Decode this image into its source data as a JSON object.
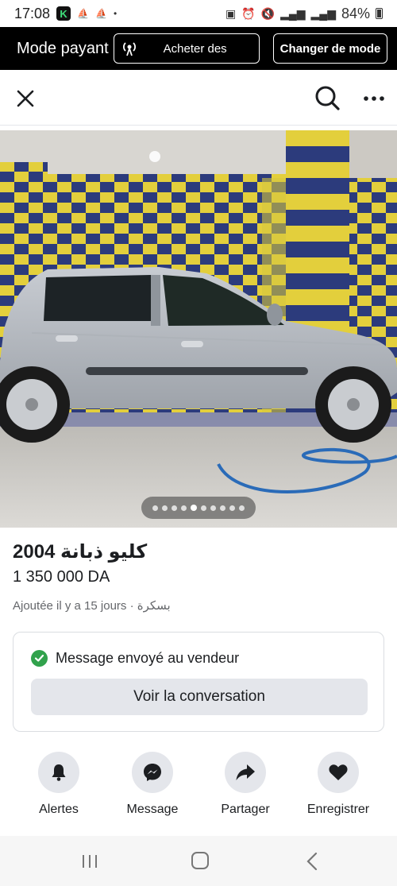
{
  "status_bar": {
    "time": "17:08",
    "notification_letter": "K",
    "battery": "84%"
  },
  "mode_bar": {
    "title": "Mode payant",
    "buy_button": "Acheter des",
    "change_button": "Changer de mode"
  },
  "top_nav": {
    "icons": [
      "close-icon",
      "search-icon",
      "more-icon"
    ]
  },
  "photo": {
    "image_count": 10,
    "current_index": 4
  },
  "listing": {
    "title": "كليو ذبانة 2004",
    "price": "1 350 000 DA",
    "meta": "Ajoutée il y a 15 jours · بسكرة"
  },
  "message_card": {
    "status": "Message envoyé au vendeur",
    "button": "Voir la conversation"
  },
  "actions": [
    {
      "label": "Alertes",
      "icon": "bell-icon"
    },
    {
      "label": "Message",
      "icon": "messenger-icon"
    },
    {
      "label": "Partager",
      "icon": "share-icon"
    },
    {
      "label": "Enregistrer",
      "icon": "heart-icon"
    }
  ],
  "colors": {
    "success_green": "#31a24c",
    "button_gray": "#e4e6eb",
    "tile_yellow": "#e8d43a",
    "tile_blue": "#2b3a7a"
  }
}
